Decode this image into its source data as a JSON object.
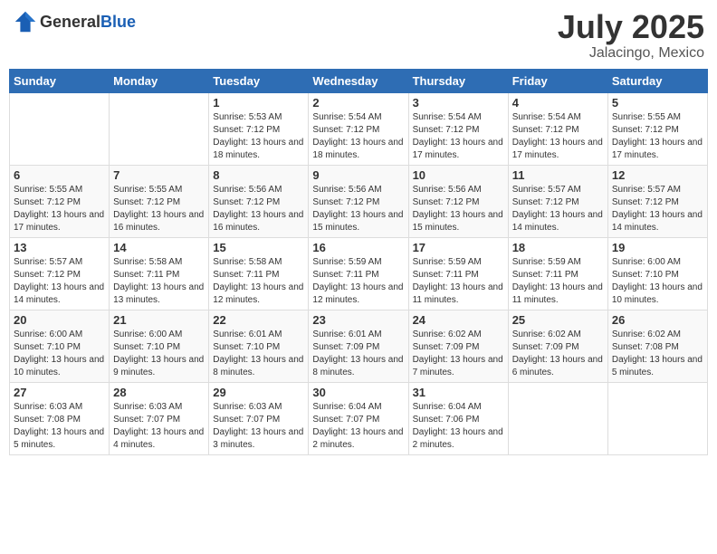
{
  "header": {
    "logo_general": "General",
    "logo_blue": "Blue",
    "month_title": "July 2025",
    "location": "Jalacingo, Mexico"
  },
  "days_of_week": [
    "Sunday",
    "Monday",
    "Tuesday",
    "Wednesday",
    "Thursday",
    "Friday",
    "Saturday"
  ],
  "weeks": [
    [
      {
        "day": "",
        "info": ""
      },
      {
        "day": "",
        "info": ""
      },
      {
        "day": "1",
        "info": "Sunrise: 5:53 AM\nSunset: 7:12 PM\nDaylight: 13 hours and 18 minutes."
      },
      {
        "day": "2",
        "info": "Sunrise: 5:54 AM\nSunset: 7:12 PM\nDaylight: 13 hours and 18 minutes."
      },
      {
        "day": "3",
        "info": "Sunrise: 5:54 AM\nSunset: 7:12 PM\nDaylight: 13 hours and 17 minutes."
      },
      {
        "day": "4",
        "info": "Sunrise: 5:54 AM\nSunset: 7:12 PM\nDaylight: 13 hours and 17 minutes."
      },
      {
        "day": "5",
        "info": "Sunrise: 5:55 AM\nSunset: 7:12 PM\nDaylight: 13 hours and 17 minutes."
      }
    ],
    [
      {
        "day": "6",
        "info": "Sunrise: 5:55 AM\nSunset: 7:12 PM\nDaylight: 13 hours and 17 minutes."
      },
      {
        "day": "7",
        "info": "Sunrise: 5:55 AM\nSunset: 7:12 PM\nDaylight: 13 hours and 16 minutes."
      },
      {
        "day": "8",
        "info": "Sunrise: 5:56 AM\nSunset: 7:12 PM\nDaylight: 13 hours and 16 minutes."
      },
      {
        "day": "9",
        "info": "Sunrise: 5:56 AM\nSunset: 7:12 PM\nDaylight: 13 hours and 15 minutes."
      },
      {
        "day": "10",
        "info": "Sunrise: 5:56 AM\nSunset: 7:12 PM\nDaylight: 13 hours and 15 minutes."
      },
      {
        "day": "11",
        "info": "Sunrise: 5:57 AM\nSunset: 7:12 PM\nDaylight: 13 hours and 14 minutes."
      },
      {
        "day": "12",
        "info": "Sunrise: 5:57 AM\nSunset: 7:12 PM\nDaylight: 13 hours and 14 minutes."
      }
    ],
    [
      {
        "day": "13",
        "info": "Sunrise: 5:57 AM\nSunset: 7:12 PM\nDaylight: 13 hours and 14 minutes."
      },
      {
        "day": "14",
        "info": "Sunrise: 5:58 AM\nSunset: 7:11 PM\nDaylight: 13 hours and 13 minutes."
      },
      {
        "day": "15",
        "info": "Sunrise: 5:58 AM\nSunset: 7:11 PM\nDaylight: 13 hours and 12 minutes."
      },
      {
        "day": "16",
        "info": "Sunrise: 5:59 AM\nSunset: 7:11 PM\nDaylight: 13 hours and 12 minutes."
      },
      {
        "day": "17",
        "info": "Sunrise: 5:59 AM\nSunset: 7:11 PM\nDaylight: 13 hours and 11 minutes."
      },
      {
        "day": "18",
        "info": "Sunrise: 5:59 AM\nSunset: 7:11 PM\nDaylight: 13 hours and 11 minutes."
      },
      {
        "day": "19",
        "info": "Sunrise: 6:00 AM\nSunset: 7:10 PM\nDaylight: 13 hours and 10 minutes."
      }
    ],
    [
      {
        "day": "20",
        "info": "Sunrise: 6:00 AM\nSunset: 7:10 PM\nDaylight: 13 hours and 10 minutes."
      },
      {
        "day": "21",
        "info": "Sunrise: 6:00 AM\nSunset: 7:10 PM\nDaylight: 13 hours and 9 minutes."
      },
      {
        "day": "22",
        "info": "Sunrise: 6:01 AM\nSunset: 7:10 PM\nDaylight: 13 hours and 8 minutes."
      },
      {
        "day": "23",
        "info": "Sunrise: 6:01 AM\nSunset: 7:09 PM\nDaylight: 13 hours and 8 minutes."
      },
      {
        "day": "24",
        "info": "Sunrise: 6:02 AM\nSunset: 7:09 PM\nDaylight: 13 hours and 7 minutes."
      },
      {
        "day": "25",
        "info": "Sunrise: 6:02 AM\nSunset: 7:09 PM\nDaylight: 13 hours and 6 minutes."
      },
      {
        "day": "26",
        "info": "Sunrise: 6:02 AM\nSunset: 7:08 PM\nDaylight: 13 hours and 5 minutes."
      }
    ],
    [
      {
        "day": "27",
        "info": "Sunrise: 6:03 AM\nSunset: 7:08 PM\nDaylight: 13 hours and 5 minutes."
      },
      {
        "day": "28",
        "info": "Sunrise: 6:03 AM\nSunset: 7:07 PM\nDaylight: 13 hours and 4 minutes."
      },
      {
        "day": "29",
        "info": "Sunrise: 6:03 AM\nSunset: 7:07 PM\nDaylight: 13 hours and 3 minutes."
      },
      {
        "day": "30",
        "info": "Sunrise: 6:04 AM\nSunset: 7:07 PM\nDaylight: 13 hours and 2 minutes."
      },
      {
        "day": "31",
        "info": "Sunrise: 6:04 AM\nSunset: 7:06 PM\nDaylight: 13 hours and 2 minutes."
      },
      {
        "day": "",
        "info": ""
      },
      {
        "day": "",
        "info": ""
      }
    ]
  ]
}
